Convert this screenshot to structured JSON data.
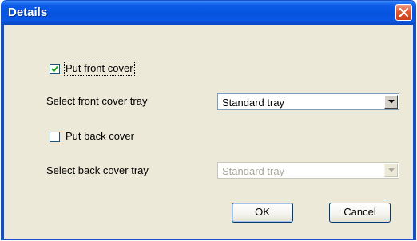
{
  "window": {
    "title": "Details"
  },
  "front_cover": {
    "checkbox_label": "Put front cover",
    "checked": true,
    "tray_label": "Select front cover tray",
    "tray_value": "Standard tray"
  },
  "back_cover": {
    "checkbox_label": "Put back cover",
    "checked": false,
    "tray_label": "Select back cover tray",
    "tray_value": "Standard tray",
    "tray_disabled": true
  },
  "buttons": {
    "ok": "OK",
    "cancel": "Cancel"
  },
  "icons": {
    "close": "close-icon",
    "check": "check-icon",
    "dropdown": "chevron-down-icon"
  },
  "colors": {
    "titlebar": "#0653de",
    "client": "#ece9d8",
    "close": "#e0582e"
  }
}
